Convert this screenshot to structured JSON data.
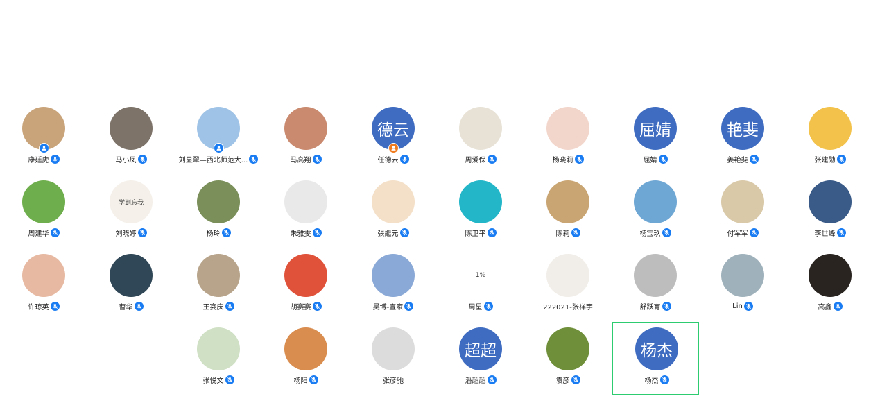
{
  "colors": {
    "accent": "#1a7cf2",
    "text_avatar": "#3f6cc1",
    "selected_border": "#2ecc71"
  },
  "participants": [
    {
      "name": "康廷虎",
      "avatar": "photo",
      "bg": "#c9a47a",
      "badge": "blue",
      "mic": "mic-icon"
    },
    {
      "name": "马小凤",
      "avatar": "photo",
      "bg": "#7d7369",
      "mic": "mic-muted-icon"
    },
    {
      "name": "刘显翠—西北师范大...",
      "avatar": "photo",
      "bg": "#9fc3e6",
      "badge": "blue",
      "mic": "mic-muted-icon"
    },
    {
      "name": "马高翔",
      "avatar": "photo",
      "bg": "#c98a6f",
      "mic": "mic-muted-icon"
    },
    {
      "name": "任德云",
      "avatar": "text",
      "avatar_text": "德云",
      "badge": "orange",
      "mic": "mic-icon"
    },
    {
      "name": "周爱保",
      "avatar": "photo",
      "bg": "#e8e2d6",
      "mic": "mic-muted-icon"
    },
    {
      "name": "杨晓莉",
      "avatar": "photo",
      "bg": "#f2d6cc",
      "mic": "mic-muted-icon"
    },
    {
      "name": "屈婧",
      "avatar": "text",
      "avatar_text": "屈婧",
      "mic": "mic-muted-icon"
    },
    {
      "name": "姜艳斐",
      "avatar": "text",
      "avatar_text": "艳斐",
      "mic": "mic-muted-icon"
    },
    {
      "name": "张建勋",
      "avatar": "photo",
      "bg": "#f2c24a",
      "mic": "mic-muted-icon"
    },
    {
      "name": "周建华",
      "avatar": "photo",
      "bg": "#6fae4c",
      "mic": "mic-muted-icon"
    },
    {
      "name": "刘晓婷",
      "avatar": "photo",
      "bg": "#f5f0ea",
      "caption": "学到忘我",
      "mic": "mic-muted-icon"
    },
    {
      "name": "杨玲",
      "avatar": "photo",
      "bg": "#7a8f5a",
      "mic": "mic-muted-icon"
    },
    {
      "name": "朱雅雯",
      "avatar": "photo",
      "bg": "#e9e9e9",
      "mic": "mic-muted-icon"
    },
    {
      "name": "張繼元",
      "avatar": "photo",
      "bg": "#f4e0c8",
      "mic": "mic-muted-icon"
    },
    {
      "name": "陈卫平",
      "avatar": "photo",
      "bg": "#22b6c8",
      "mic": "mic-muted-icon"
    },
    {
      "name": "陈莉",
      "avatar": "photo",
      "bg": "#c9a573",
      "mic": "mic-muted-icon"
    },
    {
      "name": "杨宝玖",
      "avatar": "photo",
      "bg": "#6fa7d4",
      "mic": "mic-muted-icon"
    },
    {
      "name": "付军军",
      "avatar": "photo",
      "bg": "#d9c9a8",
      "mic": "mic-muted-icon"
    },
    {
      "name": "李世峰",
      "avatar": "photo",
      "bg": "#3a5b88",
      "mic": "mic-muted-icon"
    },
    {
      "name": "许琼英",
      "avatar": "photo",
      "bg": "#e7b9a2",
      "mic": "mic-muted-icon"
    },
    {
      "name": "曹华",
      "avatar": "photo",
      "bg": "#2f4756",
      "mic": "mic-muted-icon"
    },
    {
      "name": "王宴庆",
      "avatar": "photo",
      "bg": "#b7a48a",
      "mic": "mic-muted-icon"
    },
    {
      "name": "胡赛赛",
      "avatar": "photo",
      "bg": "#e0523a",
      "mic": "mic-muted-icon"
    },
    {
      "name": "吴博-宣家",
      "avatar": "photo",
      "bg": "#8ba9d6",
      "mic": "mic-muted-icon"
    },
    {
      "name": "周星",
      "avatar": "photo",
      "bg": "#ffffff",
      "caption": "1%",
      "mic": "mic-muted-icon"
    },
    {
      "name": "222021-张祥宇",
      "avatar": "photo",
      "bg": "#f1ede8"
    },
    {
      "name": "舒跃育",
      "avatar": "photo",
      "bg": "#bdbdbd",
      "mic": "mic-muted-icon"
    },
    {
      "name": "Lin",
      "avatar": "photo",
      "bg": "#9fb1bb",
      "mic": "mic-muted-icon"
    },
    {
      "name": "高鑫",
      "avatar": "photo",
      "bg": "#2a2420",
      "mic": "mic-muted-icon"
    },
    {
      "name": "张悦文",
      "avatar": "photo",
      "bg": "#cfe0c4",
      "mic": "mic-muted-icon"
    },
    {
      "name": "杨阳",
      "avatar": "photo",
      "bg": "#d98d4f",
      "mic": "mic-muted-icon"
    },
    {
      "name": "张彦驰",
      "avatar": "photo",
      "bg": "#dcdcdc"
    },
    {
      "name": "潘超超",
      "avatar": "text",
      "avatar_text": "超超",
      "mic": "mic-muted-icon"
    },
    {
      "name": "袁彦",
      "avatar": "photo",
      "bg": "#6f8f3a",
      "mic": "mic-muted-icon"
    },
    {
      "name": "杨杰",
      "avatar": "text",
      "avatar_text": "杨杰",
      "mic": "mic-muted-icon",
      "selected": true
    }
  ]
}
